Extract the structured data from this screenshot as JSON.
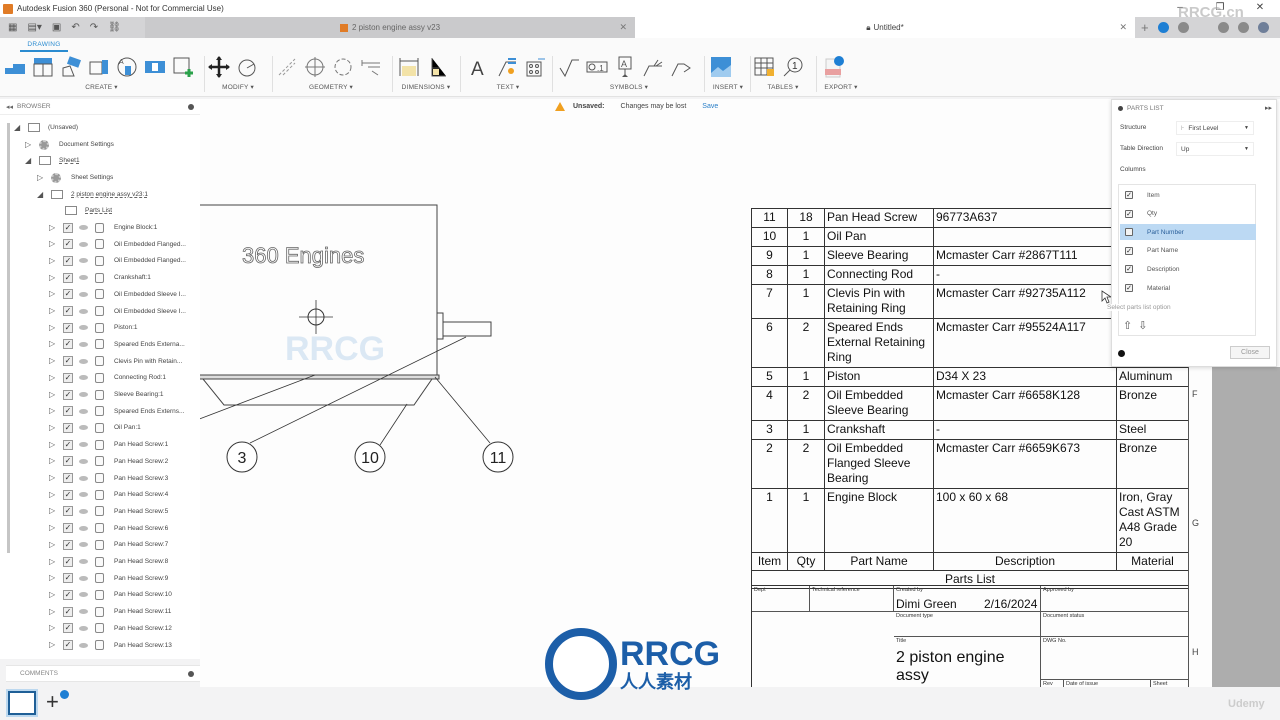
{
  "window": {
    "title": "Autodesk Fusion 360 (Personal - Not for Commercial Use)",
    "controls": [
      "–",
      "❐",
      "✕"
    ]
  },
  "tabs": [
    {
      "label": "2 piston engine assy v23",
      "active": false
    },
    {
      "label": "Untitled*",
      "active": true
    }
  ],
  "toolbar": {
    "workspace": "DRAWING",
    "groups": [
      {
        "label": "CREATE ▾"
      },
      {
        "label": "MODIFY ▾"
      },
      {
        "label": "GEOMETRY ▾"
      },
      {
        "label": "DIMENSIONS ▾"
      },
      {
        "label": "TEXT ▾"
      },
      {
        "label": "SYMBOLS ▾"
      },
      {
        "label": "INSERT ▾"
      },
      {
        "label": "TABLES ▾"
      },
      {
        "label": "EXPORT ▾"
      }
    ]
  },
  "browser": {
    "title": "BROWSER",
    "root": "(Unsaved)",
    "document_settings": "Document Settings",
    "sheet": "Sheet1",
    "sheet_settings": "Sheet Settings",
    "view": "2 piston engine assy v23:1",
    "parts_list": "Parts List",
    "components": [
      "Engine Block:1",
      "Oil Embedded Flanged...",
      "Oil Embedded Flanged...",
      "Crankshaft:1",
      "Oil Embedded Sleeve I...",
      "Oil Embedded Sleeve I...",
      "Piston:1",
      "Speared Ends Externa...",
      "Clevis Pin with Retain...",
      "Connecting Rod:1",
      "Sleeve Bearing:1",
      "Speared Ends Externs...",
      "Oil Pan:1",
      "Pan Head Screw:1",
      "Pan Head Screw:2",
      "Pan Head Screw:3",
      "Pan Head Screw:4",
      "Pan Head Screw:5",
      "Pan Head Screw:6",
      "Pan Head Screw:7",
      "Pan Head Screw:8",
      "Pan Head Screw:9",
      "Pan Head Screw:10",
      "Pan Head Screw:11",
      "Pan Head Screw:12",
      "Pan Head Screw:13"
    ]
  },
  "comments": {
    "title": "COMMENTS"
  },
  "notification": {
    "status": "Unsaved:",
    "message": "Changes may be lost",
    "action": "Save"
  },
  "drawing": {
    "engraving": "360 Engines",
    "balloons": [
      "3",
      "10",
      "11"
    ]
  },
  "parts_list_table": {
    "title": "Parts List",
    "headers": [
      "Item",
      "Qty",
      "Part Name",
      "Description",
      "Material"
    ],
    "rows": [
      {
        "item": "11",
        "qty": "18",
        "name": "Pan Head Screw",
        "desc": "96773A637",
        "material": ""
      },
      {
        "item": "10",
        "qty": "1",
        "name": "Oil Pan",
        "desc": "",
        "material": ""
      },
      {
        "item": "9",
        "qty": "1",
        "name": "Sleeve Bearing",
        "desc": "Mcmaster Carr #2867T111",
        "material": ""
      },
      {
        "item": "8",
        "qty": "1",
        "name": "Connecting Rod",
        "desc": "-",
        "material": ""
      },
      {
        "item": "7",
        "qty": "1",
        "name": "Clevis Pin with Retaining Ring",
        "desc": "Mcmaster Carr #92735A112",
        "material": ""
      },
      {
        "item": "6",
        "qty": "2",
        "name": "Speared Ends External Retaining Ring",
        "desc": "Mcmaster Carr #95524A117",
        "material": ""
      },
      {
        "item": "5",
        "qty": "1",
        "name": "Piston",
        "desc": "D34 X 23",
        "material": "Aluminum"
      },
      {
        "item": "4",
        "qty": "2",
        "name": "Oil Embedded Sleeve Bearing",
        "desc": "Mcmaster Carr #6658K128",
        "material": "Bronze"
      },
      {
        "item": "3",
        "qty": "1",
        "name": "Crankshaft",
        "desc": "-",
        "material": "Steel"
      },
      {
        "item": "2",
        "qty": "2",
        "name": "Oil Embedded Flanged Sleeve Bearing",
        "desc": "Mcmaster Carr #6659K673",
        "material": "Bronze"
      },
      {
        "item": "1",
        "qty": "1",
        "name": "Engine Block",
        "desc": "100 x 60 x 68",
        "material": "Iron, Gray Cast ASTM A48 Grade 20"
      }
    ]
  },
  "title_block": {
    "dept_label": "Dept",
    "tech_ref_label": "Technical reference",
    "created_by_label": "Created by",
    "created_by": "Dimi Green",
    "created_date": "2/16/2024",
    "approved_by_label": "Approved by",
    "doc_type_label": "Document type",
    "doc_status_label": "Document status",
    "title_label": "Title",
    "title": "2 piston engine assy",
    "dwg_no_label": "DWG No.",
    "rev_label": "Rev",
    "date_of_issue_label": "Date of issue",
    "sheet_label": "Sheet"
  },
  "border_letters": [
    "F",
    "G",
    "H"
  ],
  "parts_list_dialog": {
    "title": "PARTS LIST",
    "structure_label": "Structure",
    "structure_value": "First Level",
    "direction_label": "Table Direction",
    "direction_value": "Up",
    "columns_label": "Columns",
    "columns": [
      {
        "label": "Item",
        "checked": true
      },
      {
        "label": "Qty",
        "checked": true
      },
      {
        "label": "Part Number",
        "checked": false,
        "selected": true
      },
      {
        "label": "Part Name",
        "checked": true
      },
      {
        "label": "Description",
        "checked": true
      },
      {
        "label": "Material",
        "checked": true
      }
    ],
    "tooltip": "Select parts list option",
    "close_label": "Close"
  },
  "watermarks": {
    "rrcg": "RRCG",
    "rrcg_cn": "人人素材",
    "site": "RRCG.cn",
    "udemy": "Udemy"
  },
  "colors": {
    "accent": "#2a8bd0",
    "selection": "#bcd9f3",
    "warning": "#f0a020"
  }
}
